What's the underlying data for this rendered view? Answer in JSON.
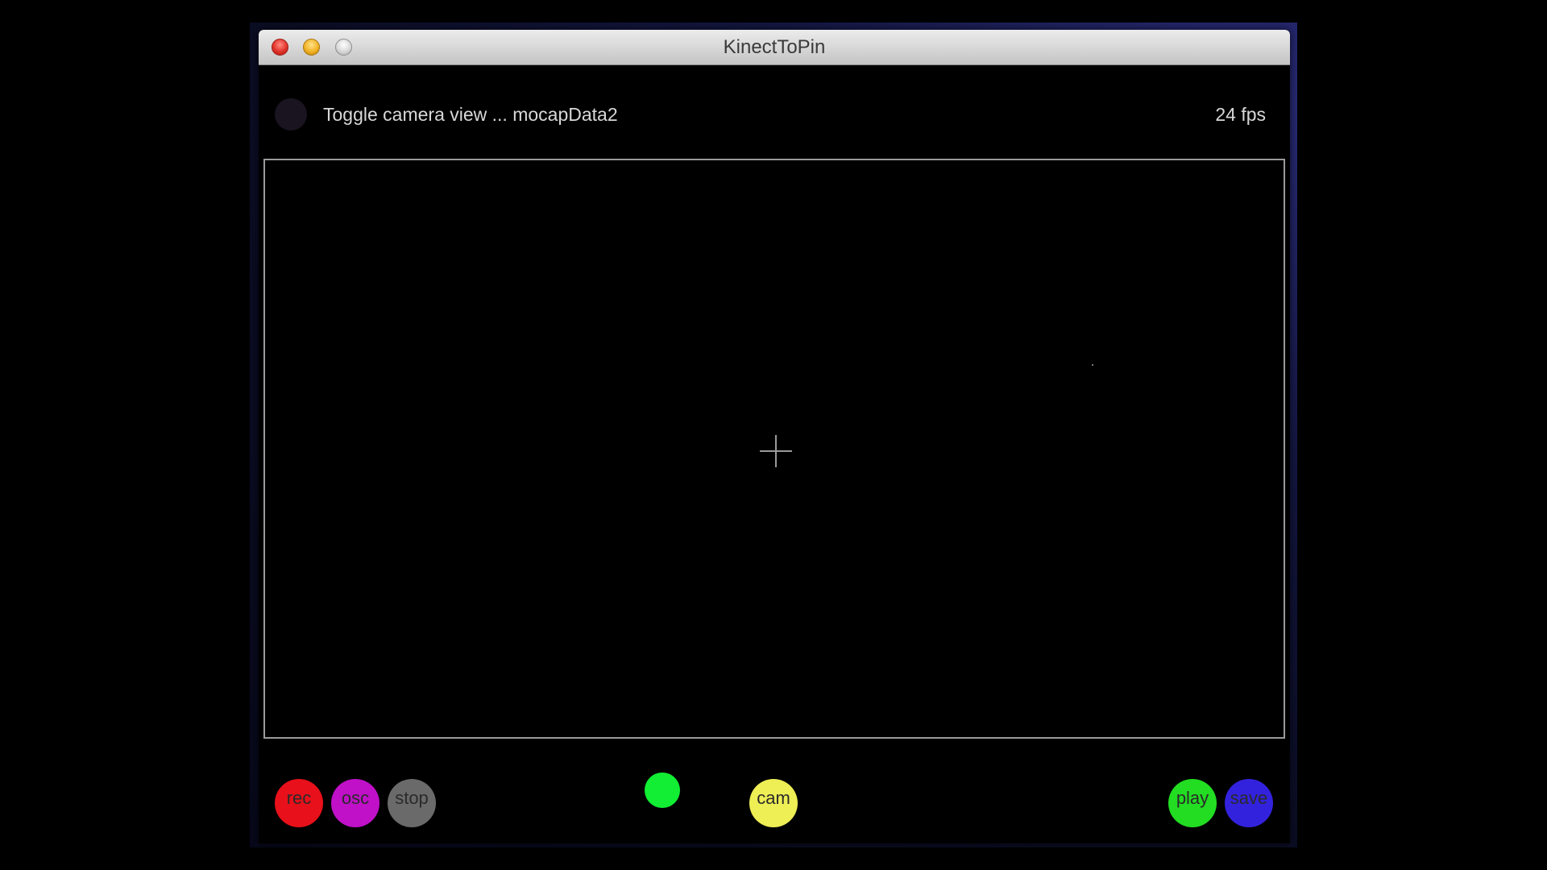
{
  "window": {
    "title": "KinectToPin"
  },
  "header": {
    "toggle_label": "Toggle camera view  ...  mocapData2",
    "fps_label": "24 fps"
  },
  "controls": {
    "rec": {
      "label": "rec",
      "color": "#e8101a"
    },
    "osc": {
      "label": "osc",
      "color": "#c010c8"
    },
    "stop": {
      "label": "stop",
      "color": "#6a6a6a"
    },
    "cam": {
      "label": "cam",
      "color": "#eeee55"
    },
    "play": {
      "label": "play",
      "color": "#22dd22"
    },
    "save": {
      "label": "save",
      "color": "#3322dd"
    }
  },
  "status_indicator": {
    "color": "#11ee33"
  },
  "icons": {
    "close": "close-icon",
    "minimize": "minimize-icon",
    "zoom": "zoom-icon",
    "crosshair": "crosshair-icon"
  }
}
